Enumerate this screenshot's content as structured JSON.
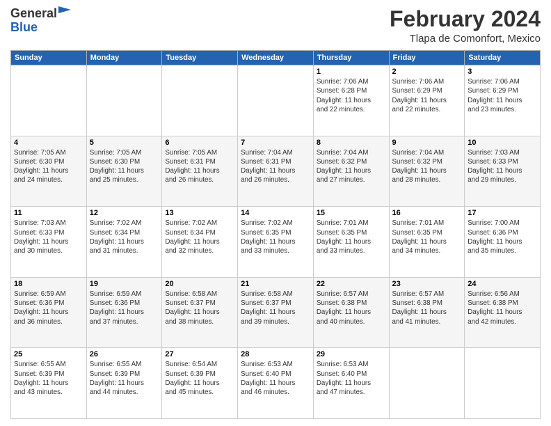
{
  "header": {
    "logo_general": "General",
    "logo_blue": "Blue",
    "month_title": "February 2024",
    "location": "Tlapa de Comonfort, Mexico"
  },
  "days_of_week": [
    "Sunday",
    "Monday",
    "Tuesday",
    "Wednesday",
    "Thursday",
    "Friday",
    "Saturday"
  ],
  "weeks": [
    [
      {
        "day": "",
        "info": ""
      },
      {
        "day": "",
        "info": ""
      },
      {
        "day": "",
        "info": ""
      },
      {
        "day": "",
        "info": ""
      },
      {
        "day": "1",
        "info": "Sunrise: 7:06 AM\nSunset: 6:28 PM\nDaylight: 11 hours\nand 22 minutes."
      },
      {
        "day": "2",
        "info": "Sunrise: 7:06 AM\nSunset: 6:29 PM\nDaylight: 11 hours\nand 22 minutes."
      },
      {
        "day": "3",
        "info": "Sunrise: 7:06 AM\nSunset: 6:29 PM\nDaylight: 11 hours\nand 23 minutes."
      }
    ],
    [
      {
        "day": "4",
        "info": "Sunrise: 7:05 AM\nSunset: 6:30 PM\nDaylight: 11 hours\nand 24 minutes."
      },
      {
        "day": "5",
        "info": "Sunrise: 7:05 AM\nSunset: 6:30 PM\nDaylight: 11 hours\nand 25 minutes."
      },
      {
        "day": "6",
        "info": "Sunrise: 7:05 AM\nSunset: 6:31 PM\nDaylight: 11 hours\nand 26 minutes."
      },
      {
        "day": "7",
        "info": "Sunrise: 7:04 AM\nSunset: 6:31 PM\nDaylight: 11 hours\nand 26 minutes."
      },
      {
        "day": "8",
        "info": "Sunrise: 7:04 AM\nSunset: 6:32 PM\nDaylight: 11 hours\nand 27 minutes."
      },
      {
        "day": "9",
        "info": "Sunrise: 7:04 AM\nSunset: 6:32 PM\nDaylight: 11 hours\nand 28 minutes."
      },
      {
        "day": "10",
        "info": "Sunrise: 7:03 AM\nSunset: 6:33 PM\nDaylight: 11 hours\nand 29 minutes."
      }
    ],
    [
      {
        "day": "11",
        "info": "Sunrise: 7:03 AM\nSunset: 6:33 PM\nDaylight: 11 hours\nand 30 minutes."
      },
      {
        "day": "12",
        "info": "Sunrise: 7:02 AM\nSunset: 6:34 PM\nDaylight: 11 hours\nand 31 minutes."
      },
      {
        "day": "13",
        "info": "Sunrise: 7:02 AM\nSunset: 6:34 PM\nDaylight: 11 hours\nand 32 minutes."
      },
      {
        "day": "14",
        "info": "Sunrise: 7:02 AM\nSunset: 6:35 PM\nDaylight: 11 hours\nand 33 minutes."
      },
      {
        "day": "15",
        "info": "Sunrise: 7:01 AM\nSunset: 6:35 PM\nDaylight: 11 hours\nand 33 minutes."
      },
      {
        "day": "16",
        "info": "Sunrise: 7:01 AM\nSunset: 6:35 PM\nDaylight: 11 hours\nand 34 minutes."
      },
      {
        "day": "17",
        "info": "Sunrise: 7:00 AM\nSunset: 6:36 PM\nDaylight: 11 hours\nand 35 minutes."
      }
    ],
    [
      {
        "day": "18",
        "info": "Sunrise: 6:59 AM\nSunset: 6:36 PM\nDaylight: 11 hours\nand 36 minutes."
      },
      {
        "day": "19",
        "info": "Sunrise: 6:59 AM\nSunset: 6:36 PM\nDaylight: 11 hours\nand 37 minutes."
      },
      {
        "day": "20",
        "info": "Sunrise: 6:58 AM\nSunset: 6:37 PM\nDaylight: 11 hours\nand 38 minutes."
      },
      {
        "day": "21",
        "info": "Sunrise: 6:58 AM\nSunset: 6:37 PM\nDaylight: 11 hours\nand 39 minutes."
      },
      {
        "day": "22",
        "info": "Sunrise: 6:57 AM\nSunset: 6:38 PM\nDaylight: 11 hours\nand 40 minutes."
      },
      {
        "day": "23",
        "info": "Sunrise: 6:57 AM\nSunset: 6:38 PM\nDaylight: 11 hours\nand 41 minutes."
      },
      {
        "day": "24",
        "info": "Sunrise: 6:56 AM\nSunset: 6:38 PM\nDaylight: 11 hours\nand 42 minutes."
      }
    ],
    [
      {
        "day": "25",
        "info": "Sunrise: 6:55 AM\nSunset: 6:39 PM\nDaylight: 11 hours\nand 43 minutes."
      },
      {
        "day": "26",
        "info": "Sunrise: 6:55 AM\nSunset: 6:39 PM\nDaylight: 11 hours\nand 44 minutes."
      },
      {
        "day": "27",
        "info": "Sunrise: 6:54 AM\nSunset: 6:39 PM\nDaylight: 11 hours\nand 45 minutes."
      },
      {
        "day": "28",
        "info": "Sunrise: 6:53 AM\nSunset: 6:40 PM\nDaylight: 11 hours\nand 46 minutes."
      },
      {
        "day": "29",
        "info": "Sunrise: 6:53 AM\nSunset: 6:40 PM\nDaylight: 11 hours\nand 47 minutes."
      },
      {
        "day": "",
        "info": ""
      },
      {
        "day": "",
        "info": ""
      }
    ]
  ]
}
